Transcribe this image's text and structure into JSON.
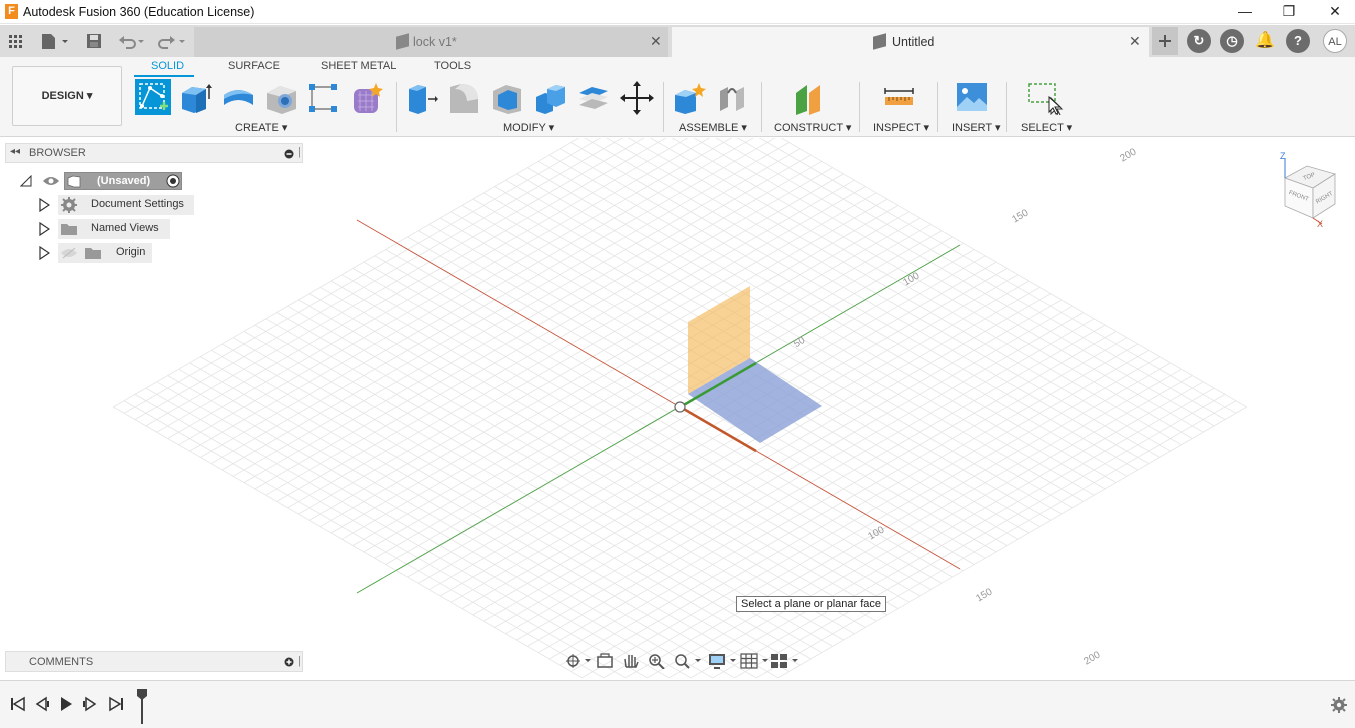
{
  "window": {
    "title": "Autodesk Fusion 360 (Education License)",
    "icon_letter": "F",
    "minimize": "—",
    "restore": "❐",
    "close": "✕"
  },
  "tabs": [
    {
      "label": "lock v1*",
      "close": "✕",
      "active": false
    },
    {
      "label": "Untitled",
      "close": "✕",
      "active": true
    }
  ],
  "user": {
    "initials": "AL"
  },
  "workspace": {
    "label": "DESIGN ▾"
  },
  "toolbar_tabs": [
    "SOLID",
    "SURFACE",
    "SHEET METAL",
    "TOOLS"
  ],
  "groups": {
    "create": "CREATE ▾",
    "modify": "MODIFY ▾",
    "assemble": "ASSEMBLE ▾",
    "construct": "CONSTRUCT ▾",
    "inspect": "INSPECT ▾",
    "insert": "INSERT ▾",
    "select": "SELECT ▾"
  },
  "browser": {
    "title": "BROWSER",
    "root": "(Unsaved)",
    "items": [
      "Document Settings",
      "Named Views",
      "Origin"
    ]
  },
  "comments": {
    "title": "COMMENTS"
  },
  "viewport": {
    "tooltip": "Select a plane or planar face",
    "grid_labels": [
      "200",
      "150",
      "100",
      "50",
      "100",
      "150",
      "200"
    ],
    "viewcube": {
      "top": "TOP",
      "front": "FRONT",
      "right": "RIGHT",
      "z": "Z",
      "x": "X"
    }
  },
  "colors": {
    "accent": "#0696d7",
    "x_axis": "#c8543a",
    "y_axis": "#4aa243",
    "plane_yz": "#f5b95a",
    "plane_xy": "#8aa0d6"
  }
}
